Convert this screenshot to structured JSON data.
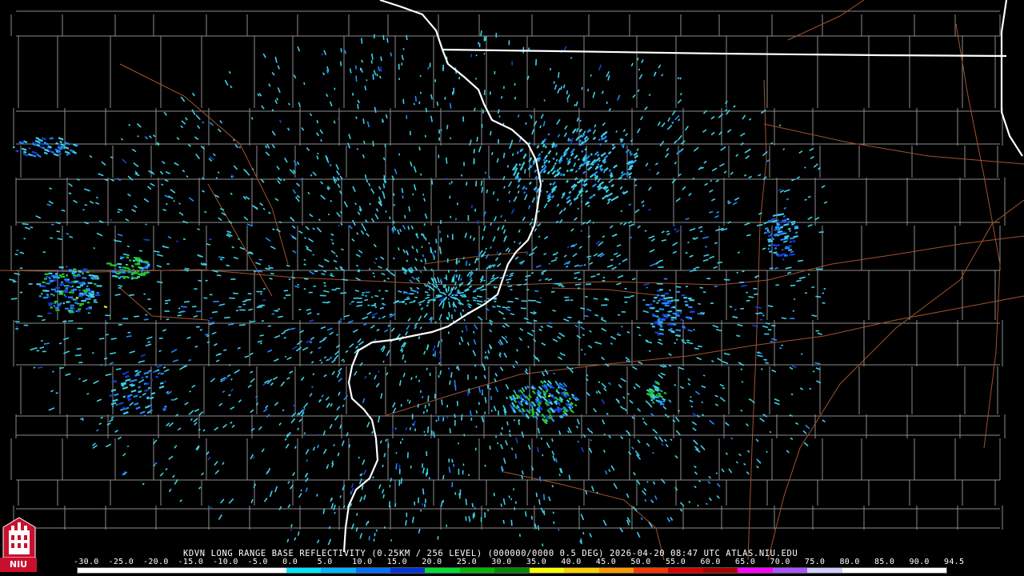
{
  "product": {
    "caption": "KDVN LONG RANGE BASE REFLECTIVITY (0.25KM / 256 LEVEL) (000000/0000 0.5 DEG) 2026-04-20 08:47 UTC  ATLAS.NIU.EDU"
  },
  "logo": {
    "text": "NIU",
    "color": "#c8102e"
  },
  "legend": {
    "labels": [
      "-30.0",
      "-25.0",
      "-20.0",
      "-15.0",
      "-10.0",
      "-5.0",
      "0.0",
      "5.0",
      "10.0",
      "15.0",
      "20.0",
      "25.0",
      "30.0",
      "35.0",
      "40.0",
      "45.0",
      "50.0",
      "55.0",
      "60.0",
      "65.0",
      "70.0",
      "75.0",
      "80.0",
      "85.0",
      "90.0",
      "94.5"
    ],
    "colors": [
      "#ffffff",
      "#ffffff",
      "#ffffff",
      "#ffffff",
      "#ffffff",
      "#ffffff",
      "#00e5ff",
      "#00b5ff",
      "#0070ff",
      "#0033dd",
      "#00dd33",
      "#00b800",
      "#008800",
      "#ffff00",
      "#ffd000",
      "#ff9900",
      "#ff3300",
      "#dd0000",
      "#aa0000",
      "#ff00ff",
      "#aa55ff",
      "#d0d0ff",
      "#ffffff",
      "#ffffff",
      "#ffffff"
    ]
  },
  "map": {
    "background": "#000000",
    "county_line_color": "#8c8c8c",
    "state_line_color": "#ffffff",
    "highway_color": "#a0522d",
    "echo_colors": {
      "light": "#3ecfe6",
      "medium": "#1f8bff",
      "strong": "#1a3fd6",
      "heavy": "#22c52a",
      "yellow": "#e6e000"
    }
  }
}
